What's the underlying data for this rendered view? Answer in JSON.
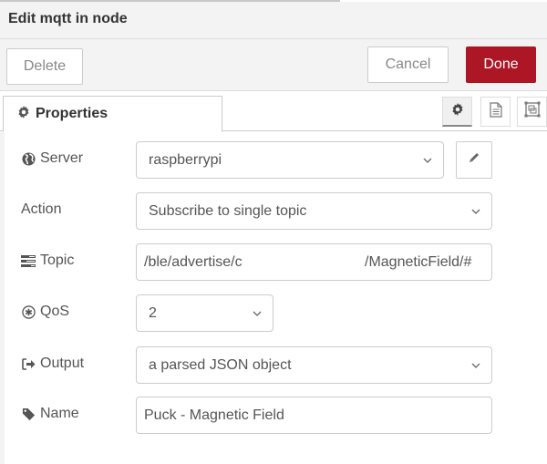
{
  "header": {
    "title": "Edit mqtt in node"
  },
  "toolbar": {
    "delete_label": "Delete",
    "cancel_label": "Cancel",
    "done_label": "Done",
    "done_color": "#ad1625"
  },
  "tabs": {
    "properties_label": "Properties",
    "icons": [
      "gear-icon",
      "description-icon",
      "appearance-icon"
    ]
  },
  "form": {
    "server": {
      "label": "Server",
      "icon": "globe-icon",
      "value": "raspberrypi"
    },
    "action": {
      "label": "Action",
      "value": "Subscribe to single topic"
    },
    "topic": {
      "label": "Topic",
      "icon": "tasks-icon",
      "value_start": "/ble/advertise/c",
      "value_end": "/MagneticField/#"
    },
    "qos": {
      "label": "QoS",
      "icon": "asterisk-circle-icon",
      "value": "2"
    },
    "output": {
      "label": "Output",
      "icon": "sign-out-icon",
      "value": "a parsed JSON object"
    },
    "name": {
      "label": "Name",
      "icon": "tag-icon",
      "value": "Puck - Magnetic Field"
    }
  }
}
